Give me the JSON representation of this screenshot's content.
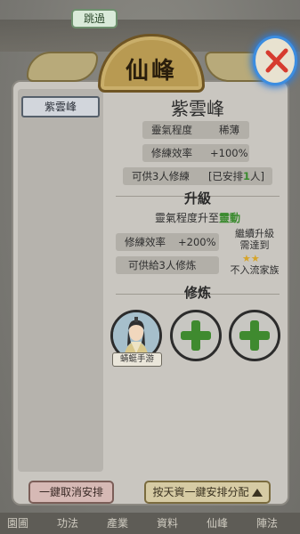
{
  "skip_label": "跳過",
  "title": "仙峰",
  "sidebar": {
    "items": [
      {
        "label": "紫雲峰"
      }
    ]
  },
  "detail": {
    "name": "紫雲峰",
    "qi_level_label": "靈氣程度",
    "qi_level_value": "稀薄",
    "efficiency_label": "修練效率",
    "efficiency_value": "+100%",
    "capacity_text_prefix": "可供3人修練",
    "capacity_assigned_prefix": "[已安排",
    "capacity_assigned_count": "1",
    "capacity_assigned_suffix": "人]"
  },
  "upgrade": {
    "heading": "升級",
    "qi_upgrade_prefix": "靈氣程度升至",
    "qi_upgrade_target": "靈動",
    "efficiency_label": "修練效率",
    "efficiency_value": "+200%",
    "capacity_text": "可供給3人修炼",
    "continue_note_line1": "繼續升級",
    "continue_note_line2": "需達到",
    "requirement_text": "不入流家族"
  },
  "cultivate": {
    "heading": "修炼",
    "disciples": [
      {
        "name": "蜻蜓手游"
      }
    ]
  },
  "buttons": {
    "cancel_all": "一鍵取消安排",
    "auto_assign": "按天資一鍵安排分配"
  },
  "bottom_nav": [
    "園圃",
    "功法",
    "產業",
    "資料",
    "仙峰",
    "陣法"
  ],
  "colors": {
    "accent_green": "#3a8a2e",
    "close_ring_blue": "#3c8de0",
    "close_x_red": "#d63b2f"
  }
}
